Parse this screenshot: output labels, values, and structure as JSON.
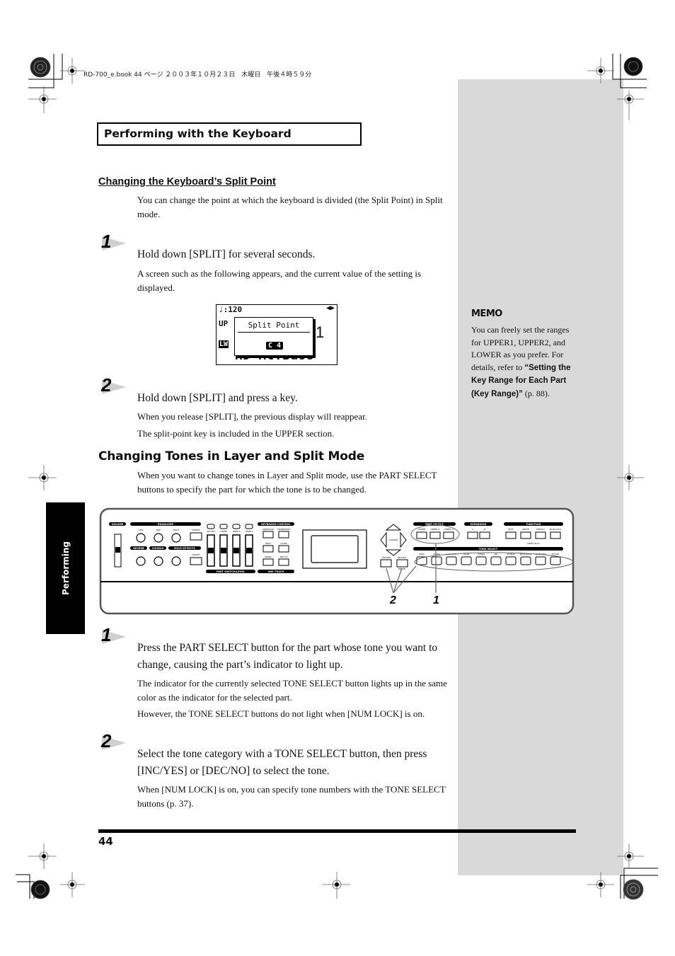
{
  "print_header": "RD-700_e.book 44 ページ ２００３年１０月２３日　木曜日　午後４時５９分",
  "section_title": "Performing with the Keyboard",
  "thumb_tab": "Performing",
  "split_point": {
    "heading": "Changing the Keyboard’s Split Point",
    "intro": "You can change the point at which the keyboard is divided (the Split Point) in Split mode.",
    "steps": [
      {
        "number": "1",
        "instruction": "Hold down [SPLIT] for several seconds.",
        "notes": [
          "A screen such as the following appears, and the current value of the setting is displayed."
        ]
      },
      {
        "number": "2",
        "instruction": "Hold down [SPLIT] and press a key.",
        "notes": [
          "When you release [SPLIT], the previous display will reappear.",
          "The split-point key is included in the UPPER section."
        ]
      }
    ]
  },
  "lcd_screen": {
    "tempo": "♩:120",
    "arrows": "◀▶",
    "row_upper": "UP",
    "row_lower": "LW",
    "popup_title": "Split Point",
    "popup_value": "C 4",
    "background_number": "1",
    "background_tone": "RD AC.Bass"
  },
  "layer_split": {
    "heading": "Changing Tones in Layer and Split Mode",
    "intro": "When you want to change tones in Layer and Split mode, use the PART SELECT buttons to specify the part for which the tone is to be changed.",
    "steps": [
      {
        "number": "1",
        "instruction": "Press the PART SELECT button for the part whose tone you want to change, causing the part’s indicator to light up.",
        "notes": [
          "The indicator for the currently selected TONE SELECT button lights up in the same color as the indicator for the selected part.",
          "However, the TONE SELECT buttons do not light when [NUM LOCK] is on."
        ]
      },
      {
        "number": "2",
        "instruction": "Select the tone category with a TONE SELECT button, then press [INC/YES] or [DEC/NO] to select the tone.",
        "notes": [
          "When [NUM LOCK] is on, you can specify tone numbers with the TONE SELECT buttons (p. 37)."
        ]
      }
    ]
  },
  "memo": {
    "title": "MEMO",
    "text_before": "You can freely set the ranges for UPPER1, UPPER2, and LOWER as you prefer. For details, refer to ",
    "link_text": "“Setting the Key Range for Each Part (Key Range)”",
    "text_after": " (p. 88)."
  },
  "panel": {
    "volume": "VOLUME",
    "equalizer": "EQUALIZER",
    "eq_knobs": [
      "LOW",
      "MID",
      "HIGH"
    ],
    "on_off": "ON/OFF",
    "reverb": "REVERB",
    "chorus": "CHORUS",
    "multi_effects": "MULTI EFFECTS",
    "part_switch_labels": [
      "RHYTHM",
      "LOWER",
      "UPPER 2",
      "UPPER 1"
    ],
    "part_switch_level": "PART SWITCH/LEVEL",
    "keyboard_control": "KEYBOARD CONTROL",
    "kc_buttons": [
      "ARPEGGIO",
      "TRANSPOSE",
      "SPLIT",
      "LAYER"
    ],
    "one_touch": "ONE TOUCH",
    "one_touch_buttons": [
      "PIANO",
      "SET UP"
    ],
    "cursor": "CURSOR",
    "dec_no": "DEC/NO",
    "inc_yes": "INC/YES",
    "enter": "ENTER",
    "part_select": "PART SELECT",
    "part_select_buttons": [
      "LOWER",
      "UPPER 2",
      "UPPER 1"
    ],
    "expansion": "EXPANSION",
    "expansion_buttons": [
      "A",
      "B"
    ],
    "function": "FUNCTION",
    "function_buttons": [
      "EDIT",
      "WRITE",
      "MIDI/TX",
      "NUM LOCK"
    ],
    "demo_play": "DEMO PLAY",
    "tone_select": "TONE SELECT",
    "tone_buttons": [
      "PIANO",
      "E.PIANO",
      "CLAV/MALLET",
      "ORGAN",
      "STRINGS",
      "PAD",
      "GTR/BASS",
      "BRASS/WINDS",
      "VOICE/SYNTH",
      "RHY/GM2"
    ],
    "callouts": [
      "2",
      "1"
    ]
  },
  "page_number": "44"
}
